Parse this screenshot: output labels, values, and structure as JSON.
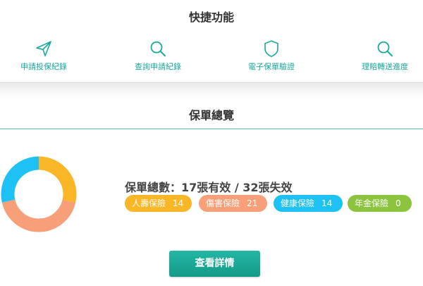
{
  "quick": {
    "title": "快捷功能",
    "items": [
      {
        "label": "申請投保紀錄",
        "icon": "send-icon"
      },
      {
        "label": "查詢申請紀錄",
        "icon": "search-icon"
      },
      {
        "label": "電子保單驗證",
        "icon": "shield-icon"
      },
      {
        "label": "理賠轉送進度",
        "icon": "search-icon"
      }
    ]
  },
  "overview": {
    "title": "保單總覽",
    "summary": "保單總數：17張有效 / 32張失效",
    "badges": [
      {
        "label": "人壽保險",
        "count": "14",
        "color": "#f9b727"
      },
      {
        "label": "傷害保險",
        "count": "21",
        "color": "#f79f79"
      },
      {
        "label": "健康保險",
        "count": "14",
        "color": "#1ec1f4"
      },
      {
        "label": "年金保險",
        "count": "0",
        "color": "#8cc43f"
      }
    ],
    "button_label": "查看詳情"
  },
  "chart_data": {
    "type": "pie",
    "donut": true,
    "categories": [
      "人壽保險",
      "傷害保險",
      "健康保險",
      "年金保險"
    ],
    "values": [
      14,
      21,
      14,
      0
    ],
    "colors": [
      "#f9b727",
      "#f79f79",
      "#1ec1f4",
      "#8cc43f"
    ]
  }
}
